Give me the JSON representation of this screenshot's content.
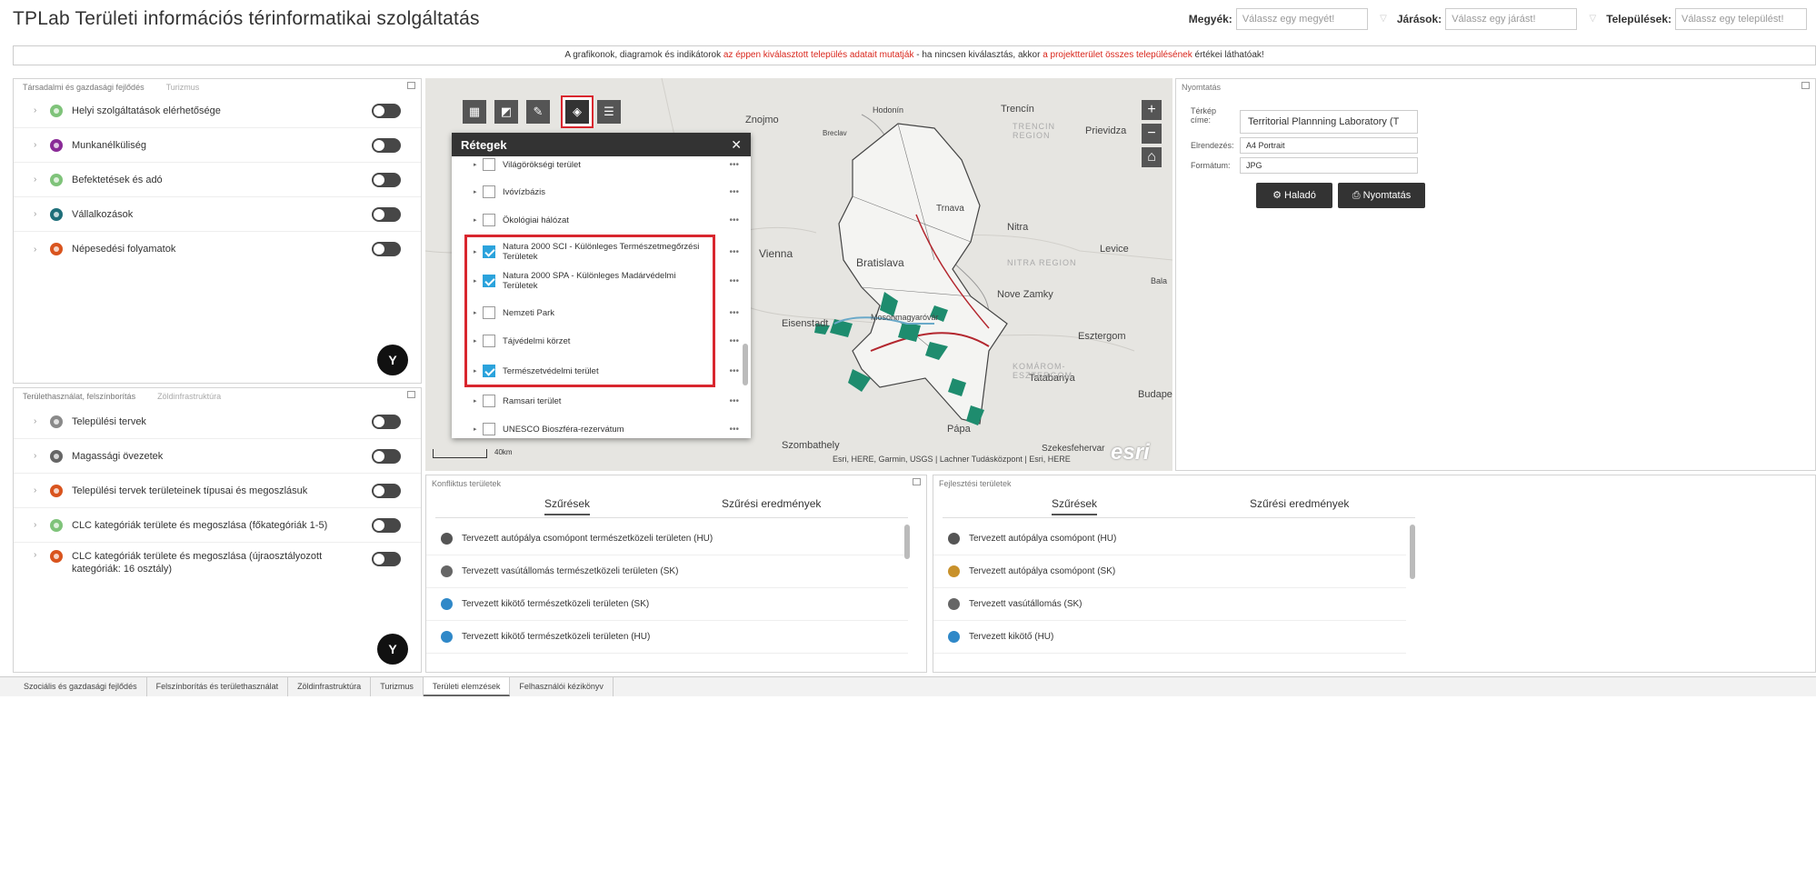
{
  "app": {
    "title": "TPLab Területi információs térinformatikai szolgáltatás"
  },
  "filters": [
    {
      "label": "Megyék:",
      "placeholder": "Válassz egy megyét!"
    },
    {
      "label": "Járások:",
      "placeholder": "Válassz egy járást!"
    },
    {
      "label": "Települések:",
      "placeholder": "Válassz egy települést!"
    }
  ],
  "notice": {
    "part1": "A grafikonok, diagramok és indikátorok ",
    "part2": "az éppen kiválasztott település adatait mutatják",
    "part3": " - ha nincsen kiválasztás, akkor ",
    "part4": "a projektterület összes településének",
    "part5": " értékei láthatóak!"
  },
  "panel_top_left": {
    "tabs": [
      "Társadalmi és gazdasági fejlődés",
      "Turizmus"
    ],
    "items": [
      {
        "label": "Helyi szolgáltatások elérhetősége",
        "color": "#7fc37a"
      },
      {
        "label": "Munkanélküliség",
        "color": "#8a2a97"
      },
      {
        "label": "Befektetések és adó",
        "color": "#7fc37a"
      },
      {
        "label": "Vállalkozások",
        "color": "#1f6f7a"
      },
      {
        "label": "Népesedési folyamatok",
        "color": "#d9541e"
      }
    ],
    "fab_icon": "filter-icon"
  },
  "panel_bottom_left": {
    "tabs": [
      "Területhasználat, felszínborítás",
      "Zöldinfrastruktúra"
    ],
    "items": [
      {
        "label": "Települési tervek",
        "color": "#8a8a8a"
      },
      {
        "label": "Magassági övezetek",
        "color": "#666666"
      },
      {
        "label": "Települési tervek területeinek típusai és megoszlásuk",
        "color": "#d9541e"
      },
      {
        "label": "CLC kategóriák területe és megoszlása (főkategóriák 1-5)",
        "color": "#7fc37a"
      },
      {
        "label": "CLC kategóriák területe és megoszlása (újraosztályozott kategóriák: 16 osztály)",
        "color": "#d9541e"
      }
    ]
  },
  "map": {
    "tool_icons": [
      "grid-icon",
      "layers-stack-icon",
      "pencil-icon",
      "layers-icon",
      "list-icon"
    ],
    "cities": [
      {
        "name": "Znojmo"
      },
      {
        "name": "Hodonín"
      },
      {
        "name": "Trencín"
      },
      {
        "name": "Prievidza"
      },
      {
        "name": "Breclav"
      },
      {
        "name": "Trnava"
      },
      {
        "name": "Nitra"
      },
      {
        "name": "Levice"
      },
      {
        "name": "Vienna"
      },
      {
        "name": "Bratislava"
      },
      {
        "name": "Nove Zamky"
      },
      {
        "name": "Eisenstadt"
      },
      {
        "name": "Mosonmagyaróvár"
      },
      {
        "name": "Esztergom"
      },
      {
        "name": "Tatabanya"
      },
      {
        "name": "Budape"
      },
      {
        "name": "Pápa"
      },
      {
        "name": "Szombathely"
      },
      {
        "name": "Szekesfehervar"
      },
      {
        "name": "Bala"
      }
    ],
    "regions": [
      "TRENCIN REGION",
      "NITRA REGION",
      "KOMÁROM-ESZTERGOM"
    ],
    "scale": "40km",
    "attribution": "Esri, HERE, Garmin, USGS | Lachner Tudásközpont | Esri, HERE",
    "esri_logo": "esri"
  },
  "layers": {
    "title": "Rétegek",
    "items": [
      {
        "label": "Világörökségi terület",
        "checked": false
      },
      {
        "label": "Ivóvízbázis",
        "checked": false
      },
      {
        "label": "Ökológiai hálózat",
        "checked": false
      },
      {
        "label": "Natura 2000 SCI - Különleges Természetmegőrzési Területek",
        "checked": true
      },
      {
        "label": "Natura 2000 SPA - Különleges Madárvédelmi Területek",
        "checked": true
      },
      {
        "label": "Nemzeti Park",
        "checked": false
      },
      {
        "label": "Tájvédelmi körzet",
        "checked": false
      },
      {
        "label": "Természetvédelmi terület",
        "checked": true
      },
      {
        "label": "Ramsari terület",
        "checked": false
      },
      {
        "label": "UNESCO Bioszféra-rezervátum",
        "checked": false
      }
    ],
    "menu_glyph": "•••"
  },
  "print": {
    "panel_title": "Nyomtatás",
    "title_label": "Térkép címe:",
    "title_value": "Territorial Plannning Laboratory (T",
    "layout_label": "Elrendezés:",
    "layout_value": "A4 Portrait",
    "format_label": "Formátum:",
    "format_value": "JPG",
    "advanced_button": "Haladó",
    "print_button": "Nyomtatás"
  },
  "conflicts": {
    "title": "Konfliktus területek",
    "tab_filters": "Szűrések",
    "tab_results": "Szűrési eredmények",
    "items": [
      {
        "label": "Tervezett autópálya csomópont természetközeli területen (HU)",
        "color": "#555555"
      },
      {
        "label": "Tervezett vasútállomás természetközeli területen (SK)",
        "color": "#666666"
      },
      {
        "label": "Tervezett kikötő természetközeli területen (SK)",
        "color": "#2f88c8"
      },
      {
        "label": "Tervezett kikötő természetközeli területen (HU)",
        "color": "#2f88c8"
      }
    ]
  },
  "development": {
    "title": "Fejlesztési területek",
    "tab_filters": "Szűrések",
    "tab_results": "Szűrési eredmények",
    "items": [
      {
        "label": "Tervezett autópálya csomópont (HU)",
        "color": "#555555"
      },
      {
        "label": "Tervezett autópálya csomópont (SK)",
        "color": "#c8912b"
      },
      {
        "label": "Tervezett vasútállomás (SK)",
        "color": "#666666"
      },
      {
        "label": "Tervezett kikötő (HU)",
        "color": "#2f88c8"
      }
    ]
  },
  "bottom_tabs": [
    "Szociális és gazdasági fejlődés",
    "Felszínborítás és területhasználat",
    "Zöldinfrastruktúra",
    "Turizmus",
    "Területi elemzések",
    "Felhasználói kézikönyv"
  ],
  "active_bottom_tab": "Területi elemzések"
}
